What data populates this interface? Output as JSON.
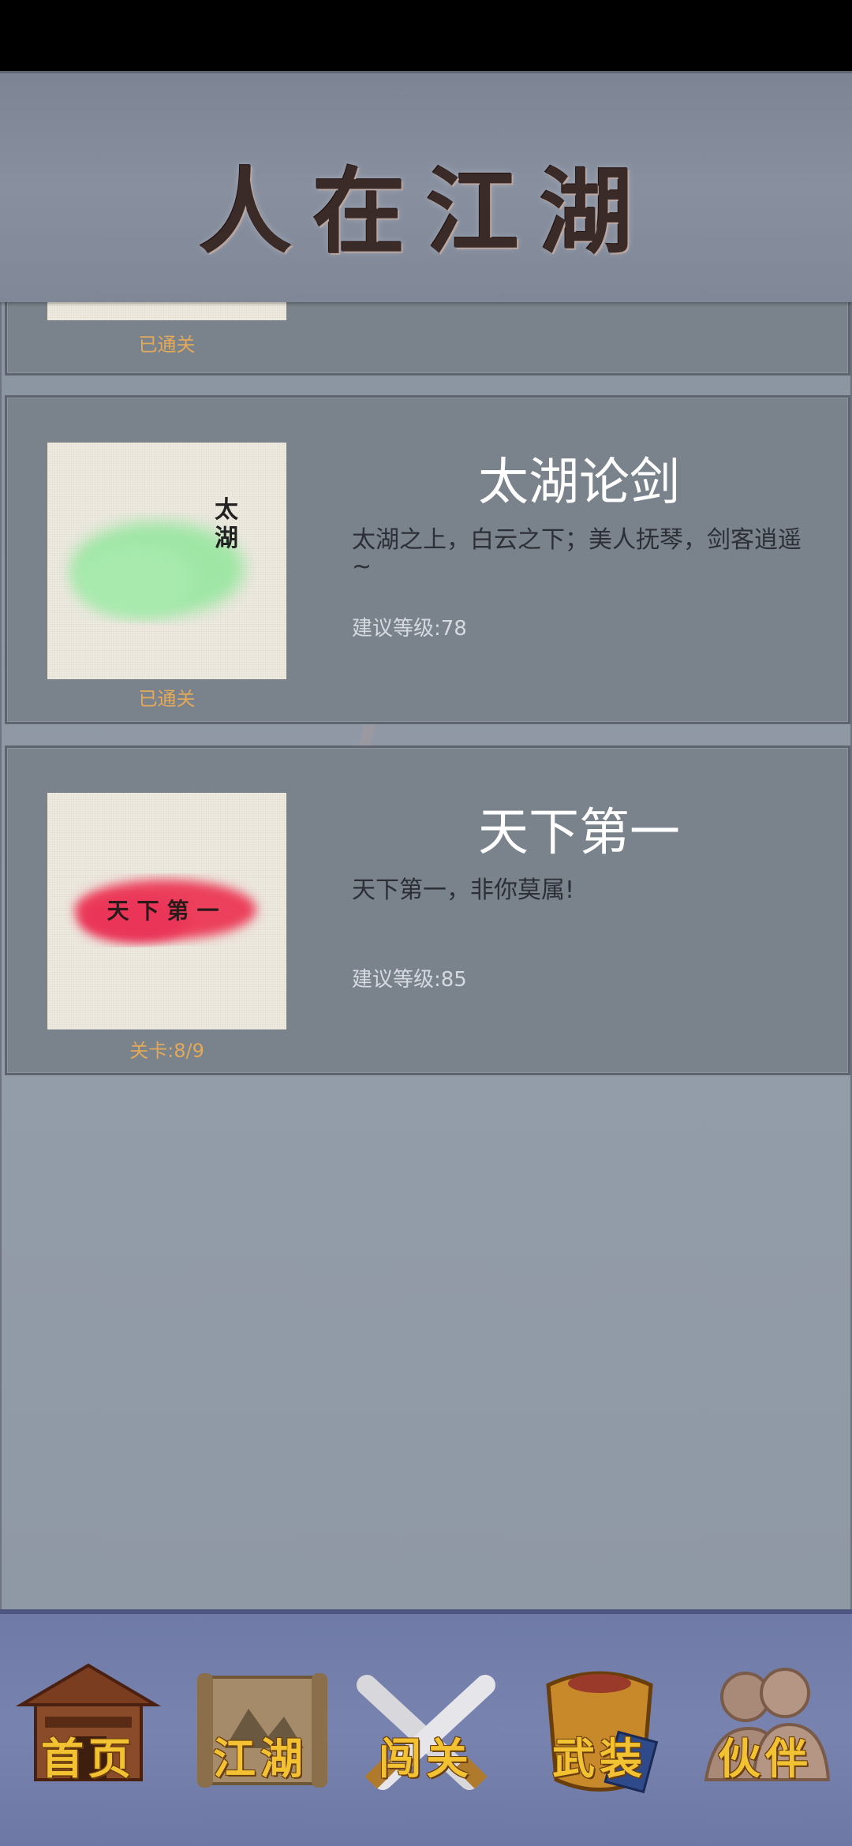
{
  "header": {
    "title": "人在江湖"
  },
  "levels": [
    {
      "status": "已通关"
    },
    {
      "name": "太湖论剑",
      "thumb_text": "太湖",
      "description": "太湖之上，白云之下；美人抚琴，剑客逍遥~",
      "requirement": "建议等级:78",
      "status": "已通关",
      "brush_color": "#9fe6a5"
    },
    {
      "name": "天下第一",
      "thumb_text": "天下第一",
      "description": "天下第一，非你莫属!",
      "requirement": "建议等级:85",
      "status": "关卡:8/9",
      "brush_color": "#ec3f5c"
    }
  ],
  "nav": [
    {
      "label": "首页",
      "icon": "house-icon"
    },
    {
      "label": "江湖",
      "icon": "scroll-map-icon"
    },
    {
      "label": "闯关",
      "icon": "crossed-swords-icon"
    },
    {
      "label": "武装",
      "icon": "armor-icon"
    },
    {
      "label": "伙伴",
      "icon": "partners-icon"
    }
  ],
  "colors": {
    "accent_gold": "#f2c232",
    "status_orange": "#e3a95a",
    "nav_background": "#7883b0",
    "card_background": "#7a828b"
  }
}
